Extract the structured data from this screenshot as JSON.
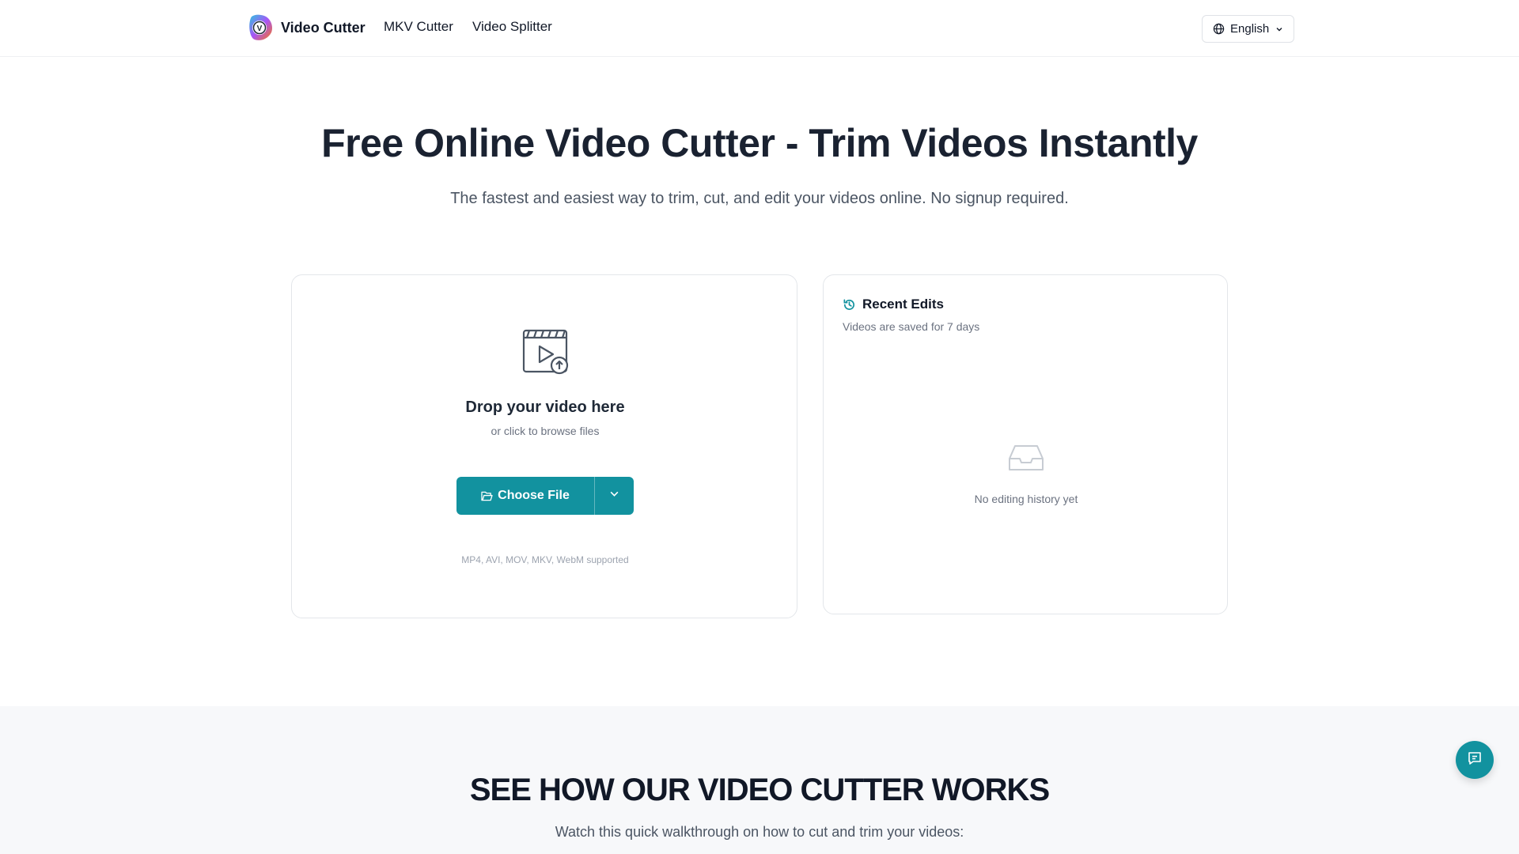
{
  "header": {
    "logo_text": "Video Cutter",
    "nav": [
      {
        "label": "MKV Cutter"
      },
      {
        "label": "Video Splitter"
      }
    ],
    "language": "English"
  },
  "hero": {
    "title": "Free Online Video Cutter - Trim Videos Instantly",
    "subtitle": "The fastest and easiest way to trim, cut, and edit your videos online. No signup required."
  },
  "upload": {
    "title": "Drop your video here",
    "subtitle": "or click to browse files",
    "button_label": "Choose File",
    "formats": "MP4, AVI, MOV, MKV, WebM supported"
  },
  "recent": {
    "title": "Recent Edits",
    "subtitle": "Videos are saved for 7 days",
    "empty": "No editing history yet"
  },
  "how": {
    "title": "SEE HOW OUR VIDEO CUTTER WORKS",
    "subtitle": "Watch this quick walkthrough on how to cut and trim your videos:"
  },
  "colors": {
    "accent": "#12929f",
    "heading": "#1a2231",
    "muted": "#6b7280"
  },
  "icons": {
    "logo": "video-cutter-logo-icon",
    "language": "globe-icon",
    "upload": "video-upload-icon",
    "button": "folder-open-icon",
    "dropdown": "chevron-down-icon",
    "recent": "history-icon",
    "empty": "inbox-icon",
    "chat": "chat-icon"
  }
}
